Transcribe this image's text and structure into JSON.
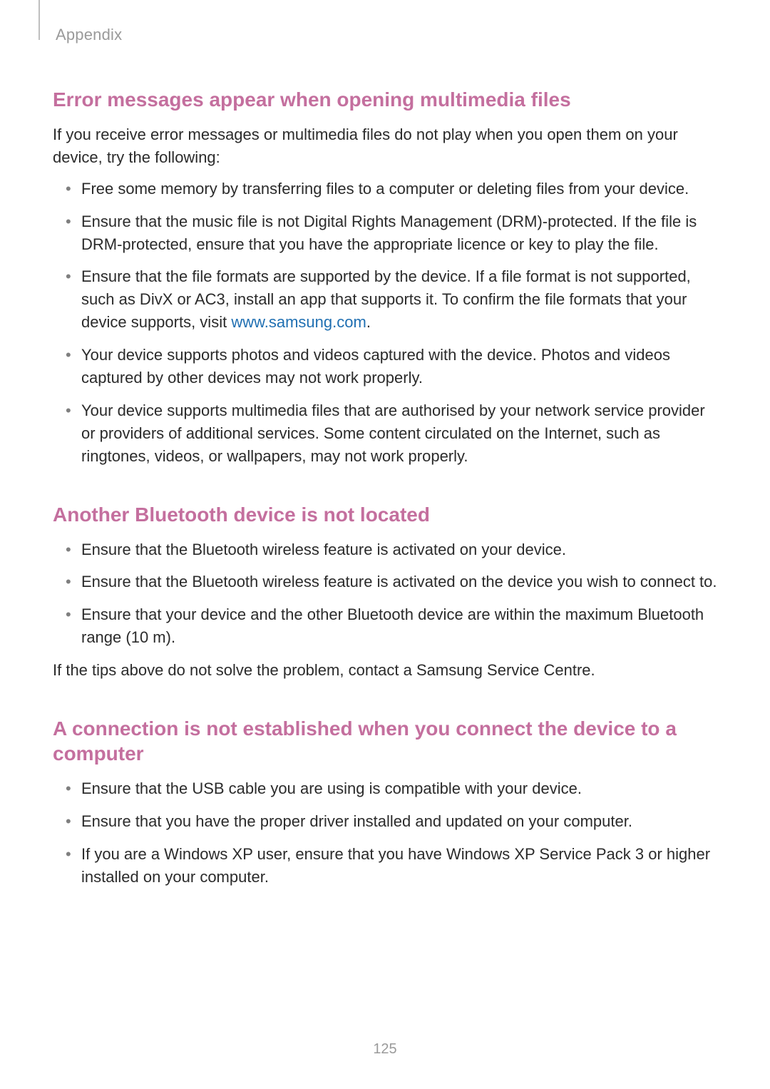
{
  "header": {
    "section_label": "Appendix"
  },
  "page_number": "125",
  "sections": [
    {
      "heading": "Error messages appear when opening multimedia files",
      "intro": "If you receive error messages or multimedia files do not play when you open them on your device, try the following:",
      "bullets": [
        {
          "text": "Free some memory by transferring files to a computer or deleting files from your device."
        },
        {
          "text": "Ensure that the music file is not Digital Rights Management (DRM)-protected. If the file is DRM-protected, ensure that you have the appropriate licence or key to play the file."
        },
        {
          "pre": "Ensure that the file formats are supported by the device. If a file format is not supported, such as DivX or AC3, install an app that supports it. To confirm the file formats that your device supports, visit ",
          "link_text": "www.samsung.com",
          "post": "."
        },
        {
          "text": "Your device supports photos and videos captured with the device. Photos and videos captured by other devices may not work properly."
        },
        {
          "text": "Your device supports multimedia files that are authorised by your network service provider or providers of additional services. Some content circulated on the Internet, such as ringtones, videos, or wallpapers, may not work properly."
        }
      ]
    },
    {
      "heading": "Another Bluetooth device is not located",
      "bullets": [
        {
          "text": "Ensure that the Bluetooth wireless feature is activated on your device."
        },
        {
          "text": "Ensure that the Bluetooth wireless feature is activated on the device you wish to connect to."
        },
        {
          "text": "Ensure that your device and the other Bluetooth device are within the maximum Bluetooth range (10 m)."
        }
      ],
      "outro": "If the tips above do not solve the problem, contact a Samsung Service Centre."
    },
    {
      "heading": "A connection is not established when you connect the device to a computer",
      "bullets": [
        {
          "text": "Ensure that the USB cable you are using is compatible with your device."
        },
        {
          "text": "Ensure that you have the proper driver installed and updated on your computer."
        },
        {
          "text": "If you are a Windows XP user, ensure that you have Windows XP Service Pack 3 or higher installed on your computer."
        }
      ]
    }
  ]
}
